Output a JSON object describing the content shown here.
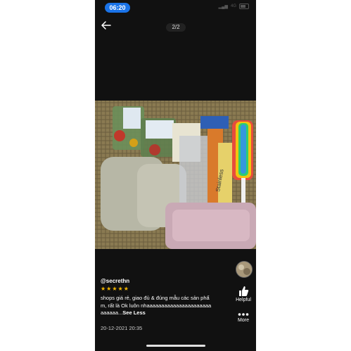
{
  "status_bar": {
    "time": "06:20",
    "network": "4G"
  },
  "viewer": {
    "page_counter": "2/2"
  },
  "review": {
    "username": "@secrethn",
    "rating": 5,
    "stars": "★★★★★",
    "text": "shops giá rẻ, giao đủ & đúng mẫu các sản phẩm, rất là Ok luôn nhaaaaaaaaaaaaaaaaaaaaaaaaaaaa...",
    "see_less_label": "See Less",
    "date": "20-12-2021 20:35"
  },
  "actions": {
    "helpful_label": "Helpful",
    "more_label": "More"
  },
  "photo": {
    "caption_tags": [
      "Stainless",
      "Stainless Steel"
    ]
  },
  "colors": {
    "background": "#111111",
    "accent": "#1a73e8",
    "stars": "#f5b800"
  }
}
